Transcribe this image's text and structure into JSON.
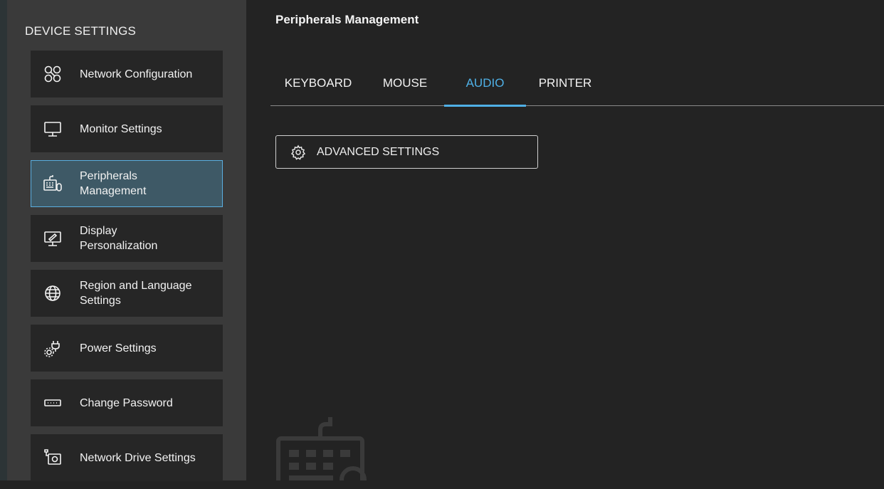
{
  "sidebar": {
    "heading": "DEVICE SETTINGS",
    "items": [
      {
        "label": "Network Configuration",
        "icon": "network-icon",
        "active": false
      },
      {
        "label": "Monitor Settings",
        "icon": "monitor-icon",
        "active": false
      },
      {
        "label": "Peripherals\nManagement",
        "icon": "peripherals-icon",
        "active": true
      },
      {
        "label": "Display\nPersonalization",
        "icon": "display-personalization-icon",
        "active": false
      },
      {
        "label": "Region and Language\nSettings",
        "icon": "globe-icon",
        "active": false
      },
      {
        "label": "Power Settings",
        "icon": "power-plug-gear-icon",
        "active": false
      },
      {
        "label": "Change Password",
        "icon": "password-icon",
        "active": false
      },
      {
        "label": "Network Drive Settings",
        "icon": "network-drive-icon",
        "active": false
      }
    ]
  },
  "main": {
    "title": "Peripherals Management",
    "tabs": [
      {
        "label": "KEYBOARD",
        "active": false
      },
      {
        "label": "MOUSE",
        "active": false
      },
      {
        "label": "AUDIO",
        "active": true
      },
      {
        "label": "PRINTER",
        "active": false
      }
    ],
    "advanced_button": {
      "label": "ADVANCED SETTINGS",
      "icon": "gear-icon"
    },
    "watermark_icon": "peripherals-watermark-icon"
  },
  "colors": {
    "background": "#232323",
    "sidebar": "#3a3a3a",
    "nav_item": "#262626",
    "active_item": "#3e5966",
    "accent": "#4fb0e6"
  }
}
